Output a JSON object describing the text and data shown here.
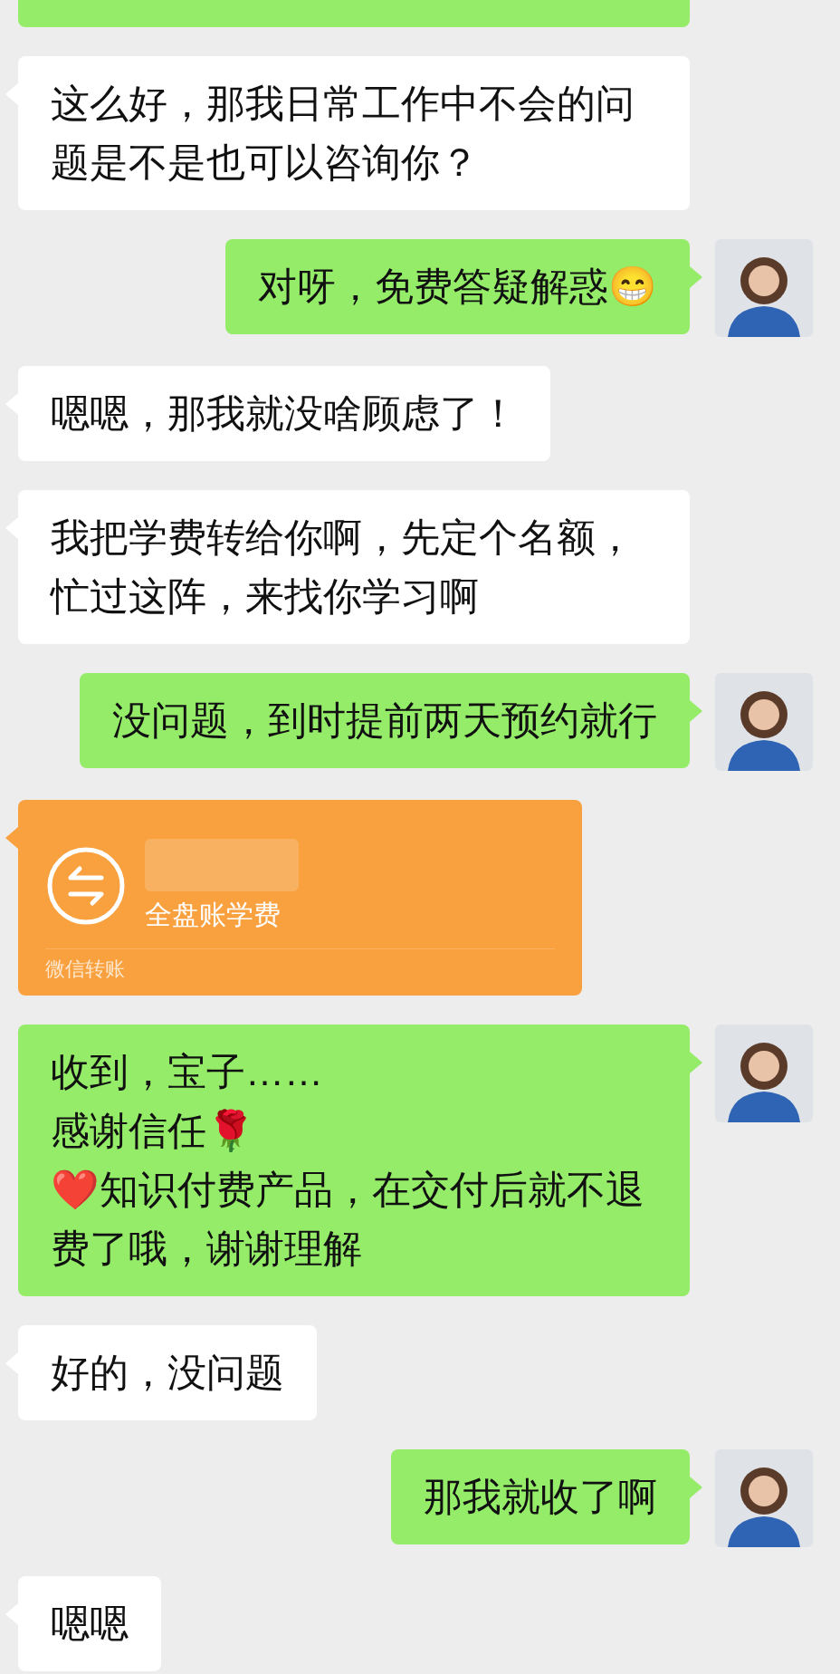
{
  "messages": [
    {
      "kind": "partial"
    },
    {
      "kind": "incoming",
      "text": "这么好，那我日常工作中不会的问题是不是也可以咨询你？"
    },
    {
      "kind": "outgoing",
      "text": "对呀，免费答疑解惑😁"
    },
    {
      "kind": "incoming",
      "text": "嗯嗯，那我就没啥顾虑了！"
    },
    {
      "kind": "incoming",
      "text": "我把学费转给你啊，先定个名额，忙过这阵，来找你学习啊"
    },
    {
      "kind": "outgoing",
      "text": "没问题，到时提前两天预约就行"
    },
    {
      "kind": "transfer",
      "note": "全盘账学费",
      "footer": "微信转账"
    },
    {
      "kind": "outgoing",
      "text": "收到，宝子……\n感谢信任🌹\n❤️知识付费产品，在交付后就不退费了哦，谢谢理解"
    },
    {
      "kind": "incoming",
      "text": "好的，没问题"
    },
    {
      "kind": "outgoing",
      "text": "那我就收了啊"
    },
    {
      "kind": "incoming",
      "text": "嗯嗯"
    }
  ]
}
